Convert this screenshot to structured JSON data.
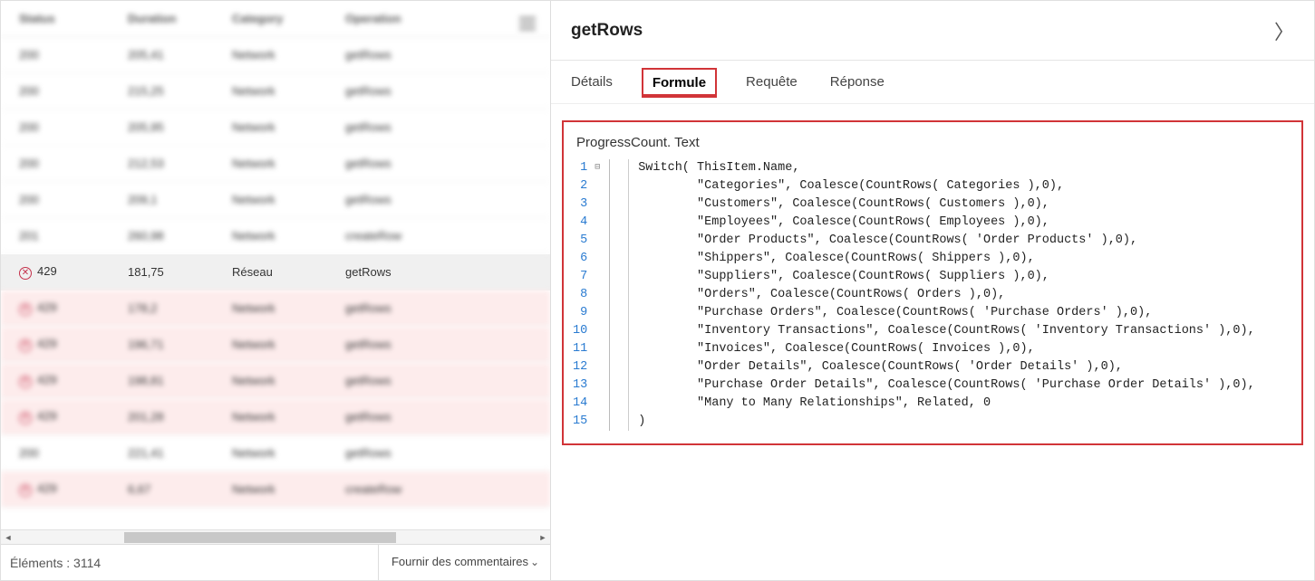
{
  "left": {
    "headers": {
      "status": "Status",
      "duration": "Duration",
      "category": "Category",
      "operation": "Operation"
    },
    "rows": [
      {
        "status": "200",
        "duration": "205,41",
        "category": "Network",
        "operation": "getRows",
        "blurred": true
      },
      {
        "status": "200",
        "duration": "215,25",
        "category": "Network",
        "operation": "getRows",
        "blurred": true
      },
      {
        "status": "200",
        "duration": "205,95",
        "category": "Network",
        "operation": "getRows",
        "blurred": true
      },
      {
        "status": "200",
        "duration": "212,53",
        "category": "Network",
        "operation": "getRows",
        "blurred": true
      },
      {
        "status": "200",
        "duration": "209,1",
        "category": "Network",
        "operation": "getRows",
        "blurred": true
      },
      {
        "status": "201",
        "duration": "260,98",
        "category": "Network",
        "operation": "createRow",
        "blurred": true
      },
      {
        "status": "429",
        "duration": "181,75",
        "category": "Réseau",
        "operation": "getRows",
        "err": true,
        "selected": true
      },
      {
        "status": "429",
        "duration": "178,2",
        "category": "Network",
        "operation": "getRows",
        "blurred": true,
        "err": true
      },
      {
        "status": "429",
        "duration": "196,71",
        "category": "Network",
        "operation": "getRows",
        "blurred": true,
        "err": true
      },
      {
        "status": "429",
        "duration": "198,81",
        "category": "Network",
        "operation": "getRows",
        "blurred": true,
        "err": true
      },
      {
        "status": "429",
        "duration": "201,28",
        "category": "Network",
        "operation": "getRows",
        "blurred": true,
        "err": true
      },
      {
        "status": "200",
        "duration": "221,41",
        "category": "Network",
        "operation": "getRows",
        "blurred": true
      },
      {
        "status": "429",
        "duration": "6,67",
        "category": "Network",
        "operation": "createRow",
        "blurred": true,
        "err": true
      }
    ],
    "footer": {
      "elements_label": "Éléments :",
      "elements_count": "3114",
      "feedback": "Fournir des commentaires"
    }
  },
  "right": {
    "title": "getRows",
    "tabs": {
      "details": "Détails",
      "formula": "Formule",
      "request": "Requête",
      "response": "Réponse",
      "active": "formula"
    },
    "code": {
      "title": "ProgressCount. Text",
      "lines": [
        "Switch( ThisItem.Name,",
        "        \"Categories\", Coalesce(CountRows( Categories ),0),",
        "        \"Customers\", Coalesce(CountRows( Customers ),0),",
        "        \"Employees\", Coalesce(CountRows( Employees ),0),",
        "        \"Order Products\", Coalesce(CountRows( 'Order Products' ),0),",
        "        \"Shippers\", Coalesce(CountRows( Shippers ),0),",
        "        \"Suppliers\", Coalesce(CountRows( Suppliers ),0),",
        "        \"Orders\", Coalesce(CountRows( Orders ),0),",
        "        \"Purchase Orders\", Coalesce(CountRows( 'Purchase Orders' ),0),",
        "        \"Inventory Transactions\", Coalesce(CountRows( 'Inventory Transactions' ),0),",
        "        \"Invoices\", Coalesce(CountRows( Invoices ),0),",
        "        \"Order Details\", Coalesce(CountRows( 'Order Details' ),0),",
        "        \"Purchase Order Details\", Coalesce(CountRows( 'Purchase Order Details' ),0),",
        "        \"Many to Many Relationships\", Related, 0",
        ")"
      ]
    }
  }
}
